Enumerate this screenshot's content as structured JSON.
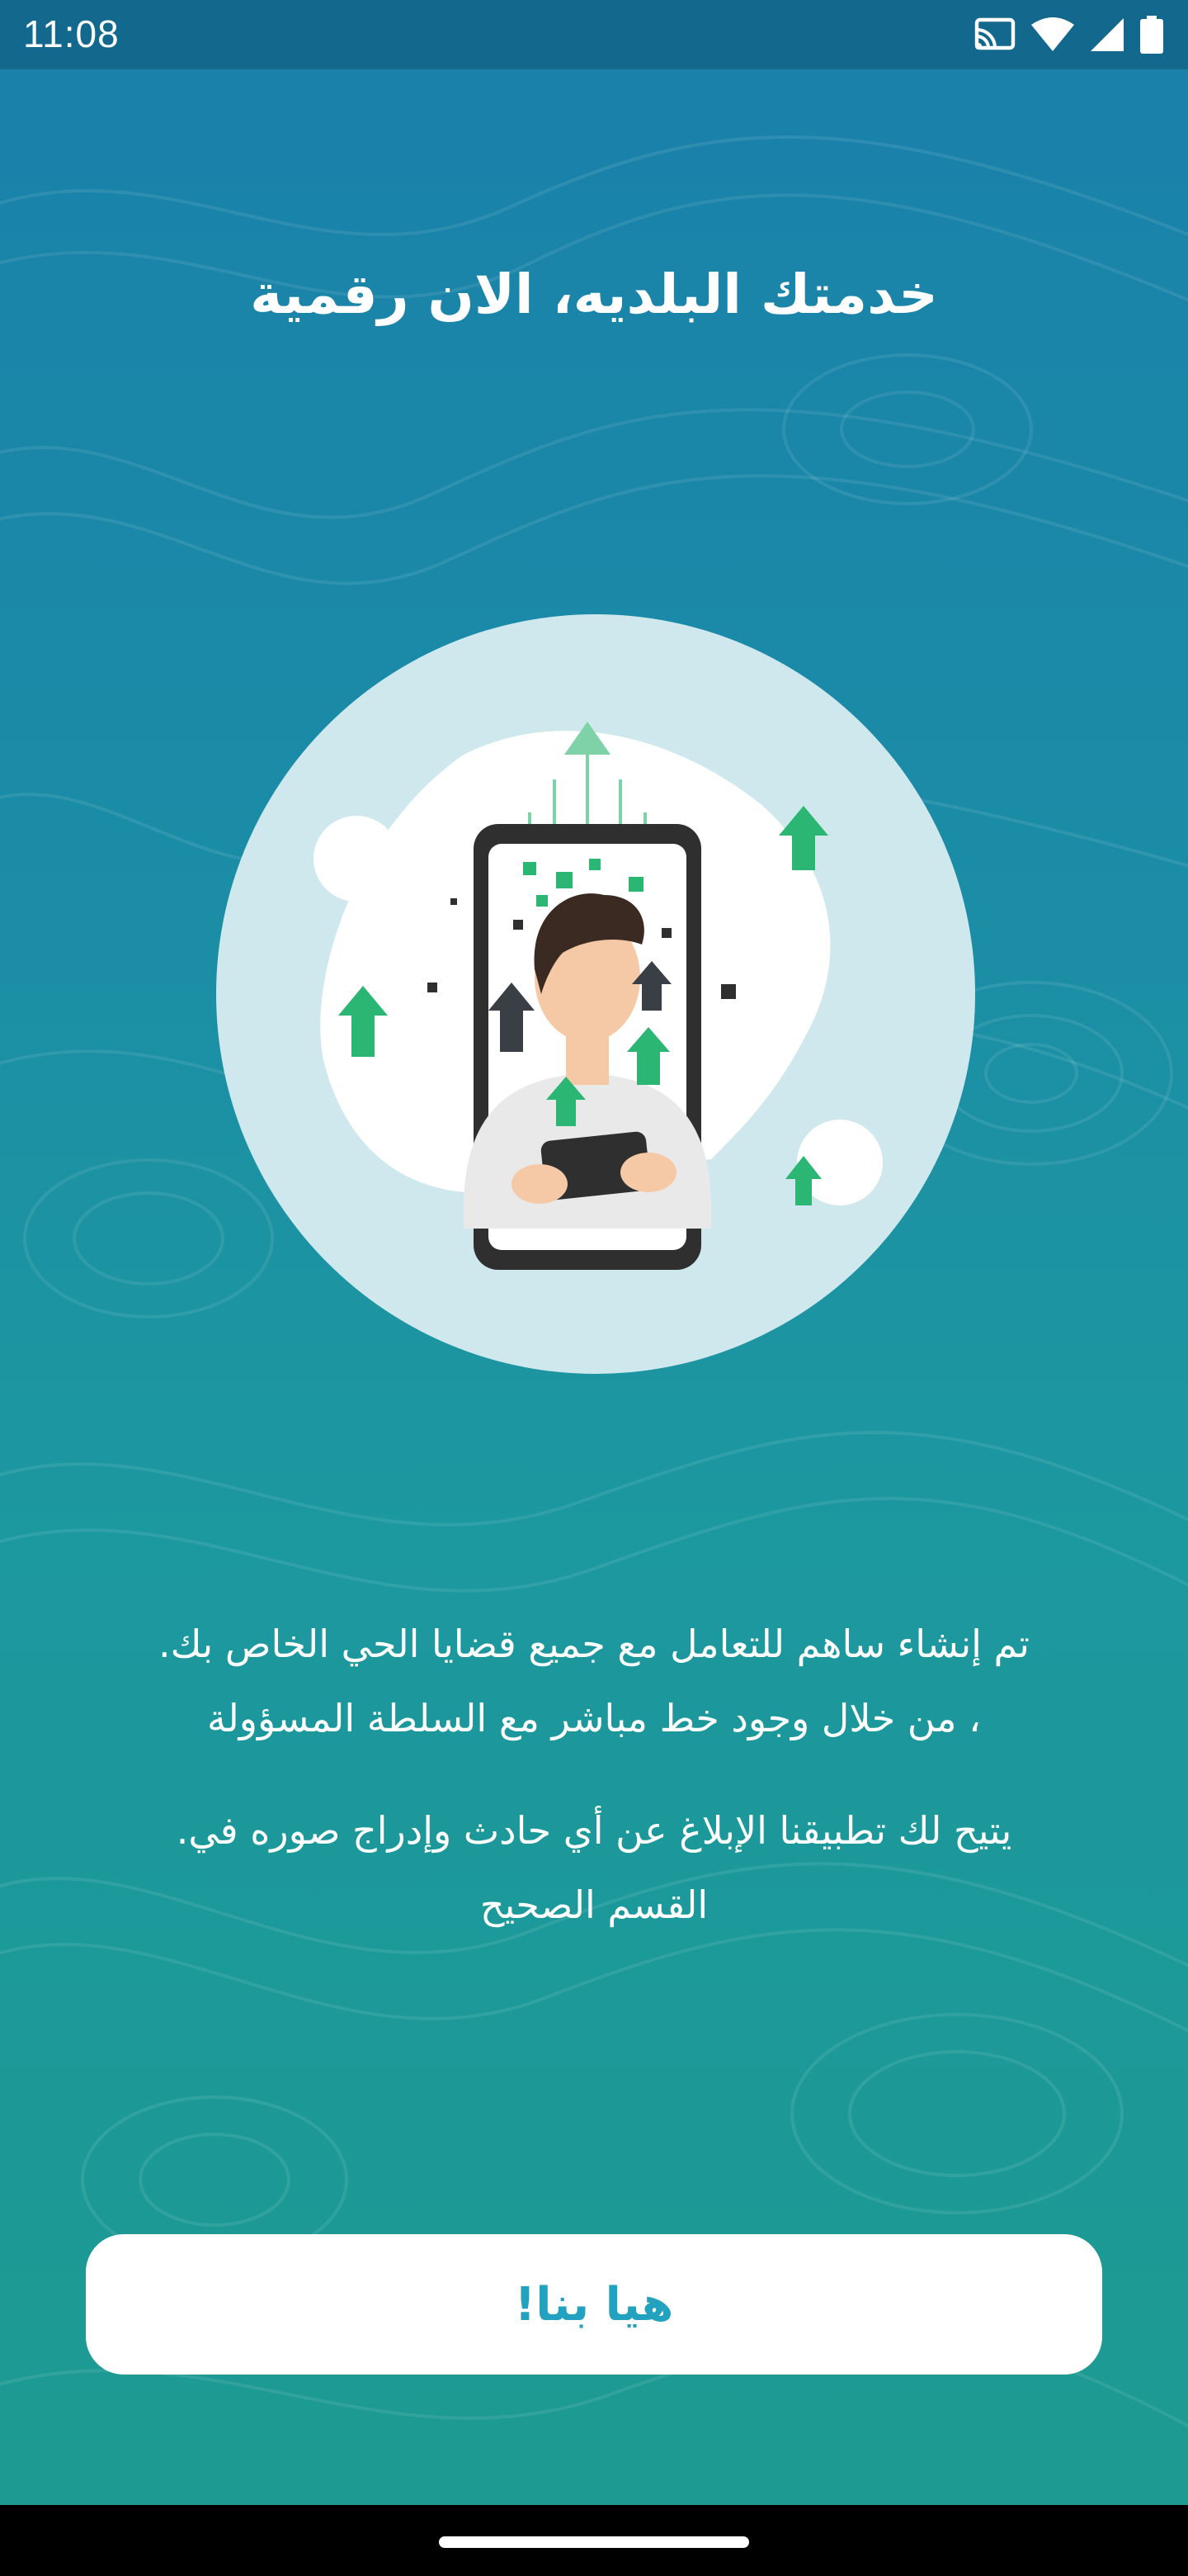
{
  "status_bar": {
    "time": "11:08",
    "icons": [
      "cast-icon",
      "wifi-icon",
      "signal-icon",
      "battery-icon"
    ]
  },
  "onboarding": {
    "title": "خدمتك البلديه، الان رقمية",
    "paragraph_1": {
      "line_1": "تم إنشاء ساهم للتعامل مع جميع قضايا الحي الخاص بك.",
      "line_2": "، من خلال وجود خط مباشر مع السلطة المسؤولة"
    },
    "paragraph_2": {
      "line_1": "يتيح لك تطبيقنا الإبلاغ عن أي حادث وإدراج صوره في.",
      "line_2": "القسم الصحيح"
    },
    "cta_label": "هيا بنا!"
  },
  "colors": {
    "background_top": "#1a80aa",
    "background_bottom": "#1d9a90",
    "accent": "#23a2bf",
    "illustration_green": "#2bb673"
  }
}
